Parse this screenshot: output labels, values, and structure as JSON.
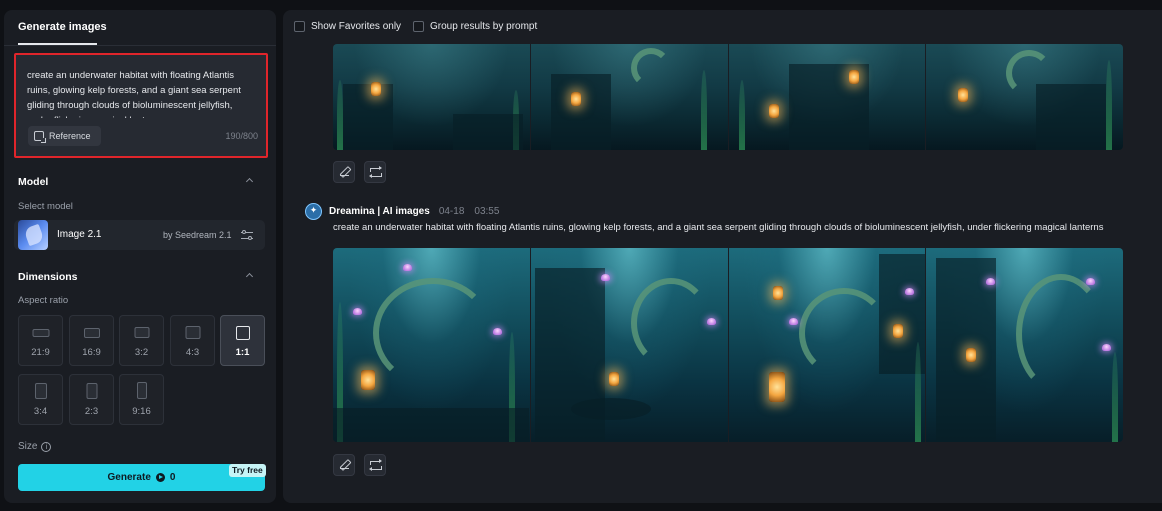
{
  "left_panel": {
    "tab_label": "Generate images",
    "prompt_text": "create an underwater habitat with floating Atlantis ruins, glowing kelp forests, and a giant sea serpent gliding through clouds of bioluminescent jellyfish, under flickering magical lanterns",
    "reference_label": "Reference",
    "char_count": "190/800",
    "model_section": {
      "title": "Model",
      "select_label": "Select model",
      "model_name": "Image 2.1",
      "model_by": "by Seedream 2.1"
    },
    "dimensions_section": {
      "title": "Dimensions",
      "aspect_label": "Aspect ratio",
      "ratios": [
        "21:9",
        "16:9",
        "3:2",
        "4:3",
        "1:1",
        "3:4",
        "2:3",
        "9:16"
      ],
      "selected_ratio": "1:1",
      "size_label": "Size",
      "info_glyph": "i"
    },
    "generate": {
      "label": "Generate",
      "credits": "0",
      "badge": "Try free"
    }
  },
  "right_panel": {
    "show_favorites_label": "Show Favorites only",
    "group_by_prompt_label": "Group results by prompt",
    "generation": {
      "author": "Dreamina | AI images",
      "date": "04-18",
      "time": "03:55",
      "prompt": "create an underwater habitat with floating Atlantis ruins, glowing kelp forests, and a giant sea serpent gliding through clouds of bioluminescent jellyfish, under flickering magical lanterns"
    }
  },
  "colors": {
    "accent": "#22d2e6",
    "highlight_border": "#e0252b",
    "panel_bg": "#1a1d23",
    "page_bg": "#0f1115"
  },
  "icons": [
    "reference-icon",
    "chevron-up-icon",
    "settings-sliders-icon",
    "info-icon",
    "credit-icon",
    "pencil-icon",
    "repeat-icon",
    "dreamina-logo-icon"
  ]
}
